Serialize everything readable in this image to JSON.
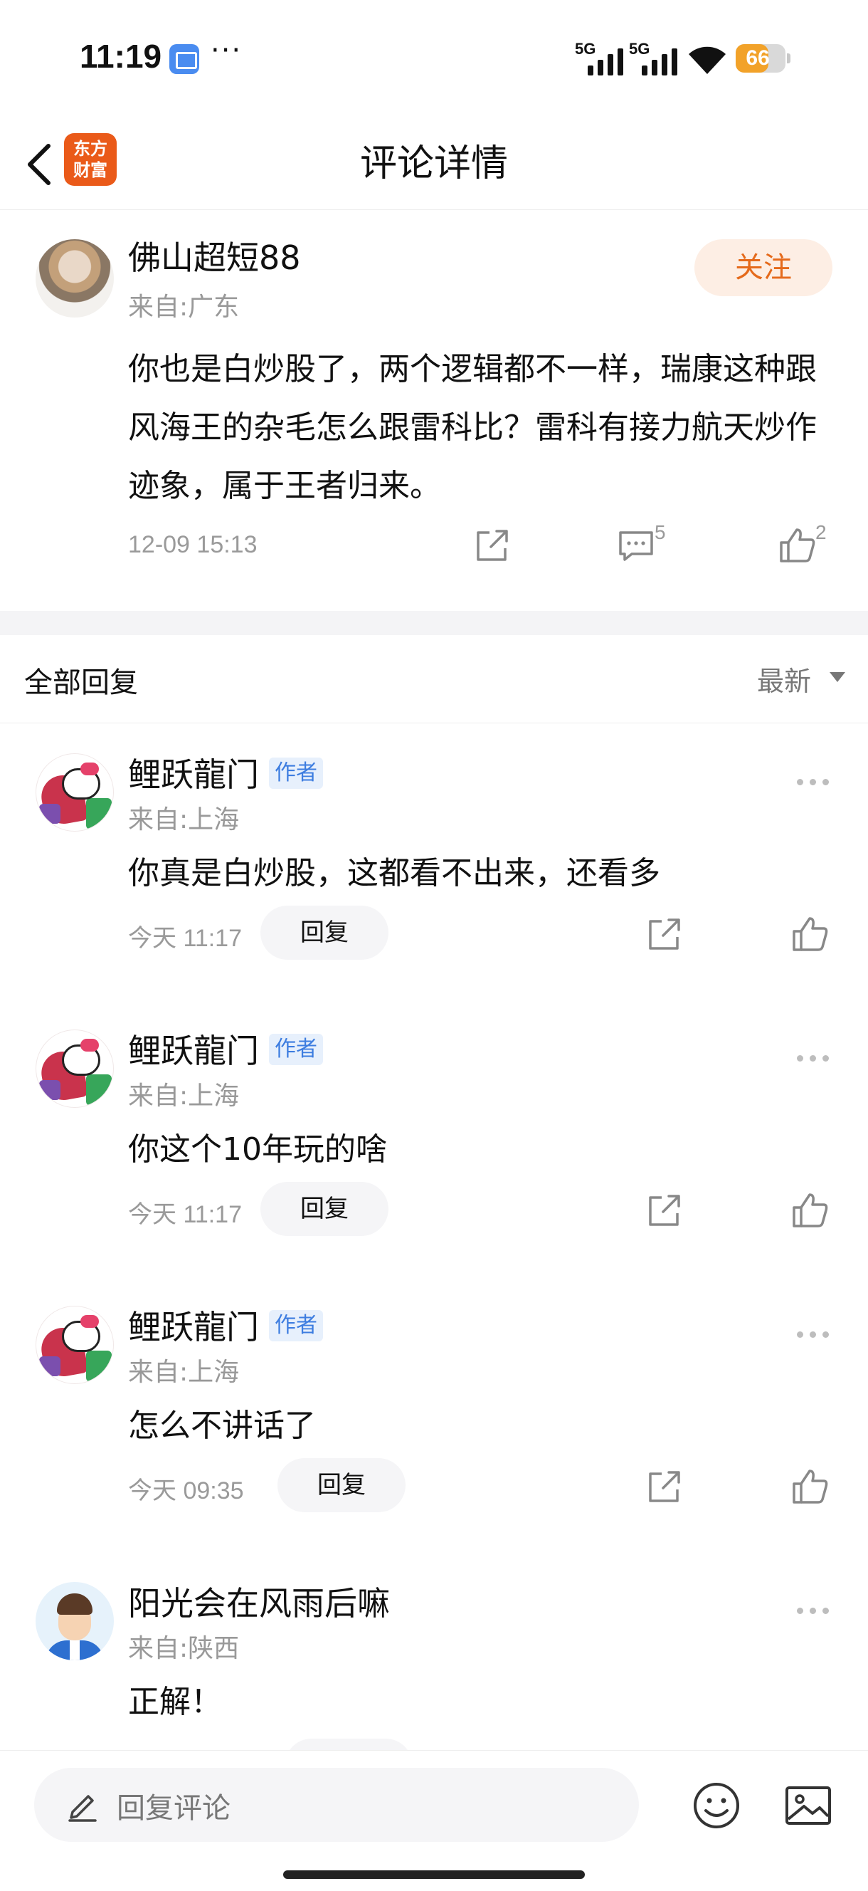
{
  "status_bar": {
    "time": "11:19",
    "more": "···",
    "signal_1": "5G",
    "signal_2": "5G",
    "battery": "66",
    "battery_level": 0.66
  },
  "header": {
    "title": "评论详情",
    "logo_text": "东方财富",
    "back_icon": "chevron-left-icon"
  },
  "main_comment": {
    "author": "佛山超短88",
    "location": "来自:广东",
    "follow_label": "关注",
    "text": "你也是白炒股了，两个逻辑都不一样，瑞康这种跟风海王的杂毛怎么跟雷科比？雷科有接力航天炒作迹象，属于王者归来。",
    "time": "12-09 15:13",
    "comment_count": "5",
    "like_count": "2"
  },
  "replies_section": {
    "title": "全部回复",
    "sort_label": "最新"
  },
  "replies": [
    {
      "author": "鲤跃龍门",
      "badge": "作者",
      "location": "来自:上海",
      "text": "你真是白炒股，这都看不出来，还看多",
      "time": "今天 11:17",
      "reply_label": "回复"
    },
    {
      "author": "鲤跃龍门",
      "badge": "作者",
      "location": "来自:上海",
      "text": "你这个10年玩的啥",
      "time": "今天 11:17",
      "reply_label": "回复"
    },
    {
      "author": "鲤跃龍门",
      "badge": "作者",
      "location": "来自:上海",
      "text": "怎么不讲话了",
      "time": "今天 09:35",
      "reply_label": "回复"
    },
    {
      "author": "阳光会在风雨后嘛",
      "badge": "",
      "location": "来自:陕西",
      "text": "正解！",
      "time": "",
      "reply_label": ""
    }
  ],
  "bottom_bar": {
    "input_placeholder": "回复评论"
  },
  "colors": {
    "accent": "#e56a1b",
    "follow_bg": "#fdeee4",
    "badge_text": "#3d7de0",
    "badge_bg": "#e7f0fc",
    "logo": "#ea5a19"
  }
}
